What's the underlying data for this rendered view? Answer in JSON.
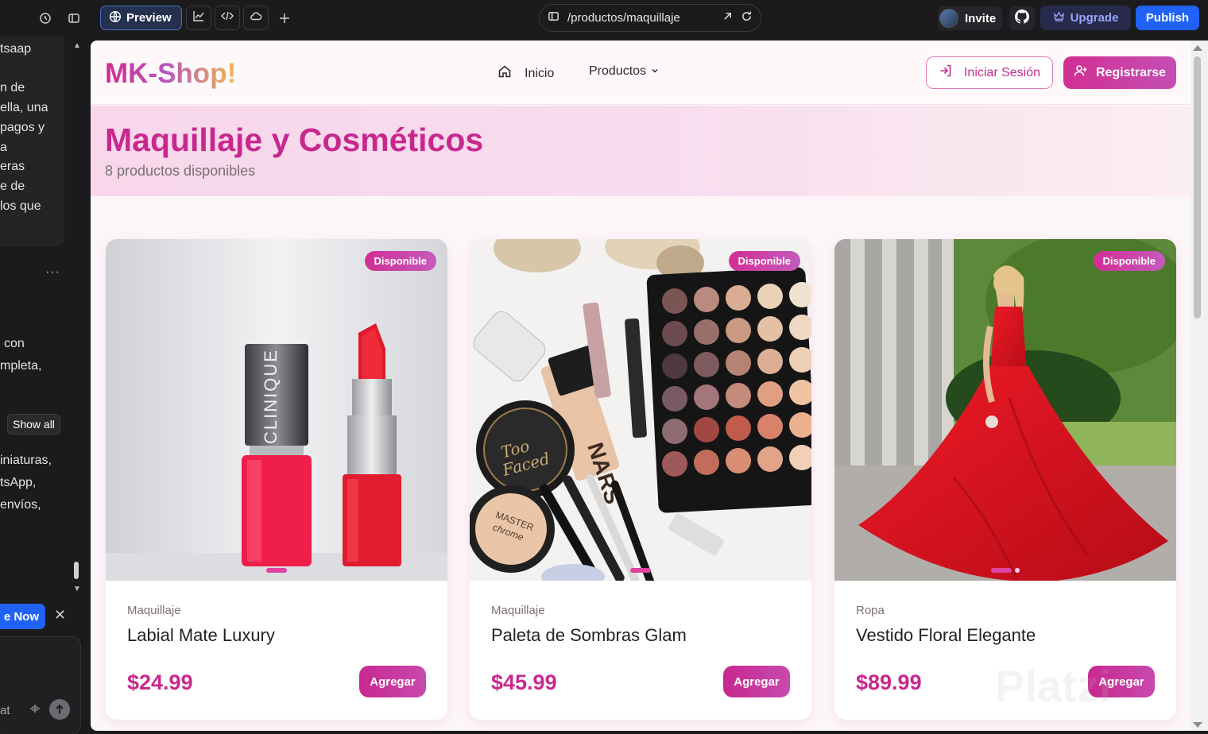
{
  "toolbar": {
    "preview_label": "Preview",
    "url": "/productos/maquillaje",
    "invite_label": "Invite",
    "upgrade_label": "Upgrade",
    "publish_label": "Publish"
  },
  "chat": {
    "lines_top": [
      "tsaap",
      "",
      "n de",
      "ella, una",
      "pagos y",
      "a",
      "eras",
      "e de",
      "los que"
    ],
    "lines_mid": [
      "con",
      "mpleta,"
    ],
    "show_all_label": "Show all",
    "lines_bottom": [
      "iniaturas,",
      "tsApp,",
      "envíos,"
    ],
    "upgrade_now_label": "e Now",
    "input_hint": "at"
  },
  "site": {
    "logo": "MK-Shop!",
    "nav": {
      "home_label": "Inicio",
      "products_label": "Productos"
    },
    "login_label": "Iniciar Sesión",
    "register_label": "Registrarse",
    "hero": {
      "title": "Maquillaje y Cosméticos",
      "subtitle": "8 productos disponibles"
    },
    "add_label": "Agregar",
    "products": [
      {
        "badge": "Disponible",
        "category": "Maquillaje",
        "name": "Labial Mate Luxury",
        "price": "$24.99"
      },
      {
        "badge": "Disponible",
        "category": "Maquillaje",
        "name": "Paleta de Sombras Glam",
        "price": "$45.99"
      },
      {
        "badge": "Disponible",
        "category": "Ropa",
        "name": "Vestido Floral Elegante",
        "price": "$89.99"
      }
    ]
  },
  "colors": {
    "accent": "#c8288e",
    "publish_blue": "#1f62f5",
    "hero_bg": "#f8d7ea"
  },
  "watermark": "Platzi"
}
